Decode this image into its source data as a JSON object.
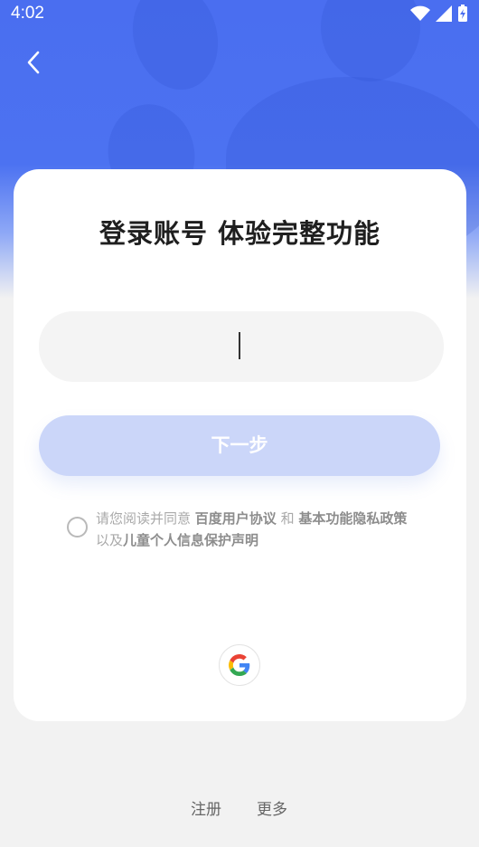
{
  "status_bar": {
    "time": "4:02"
  },
  "card": {
    "title": "登录账号 体验完整功能",
    "input_value": "",
    "next_label": "下一步",
    "agreement": {
      "prefix": "请您阅读并同意 ",
      "link1": "百度用户协议",
      "middle": " 和 ",
      "link2": "基本功能隐私政策",
      "middle2": " 以及",
      "link3": "儿童个人信息保护声明"
    }
  },
  "footer": {
    "register_label": "注册",
    "more_label": "更多"
  },
  "colors": {
    "brand": "#4a6ef0",
    "button_disabled": "#cbd6f9"
  },
  "icons": [
    "back-icon",
    "wifi-icon",
    "signal-icon",
    "battery-icon",
    "google-icon",
    "radio-icon"
  ]
}
